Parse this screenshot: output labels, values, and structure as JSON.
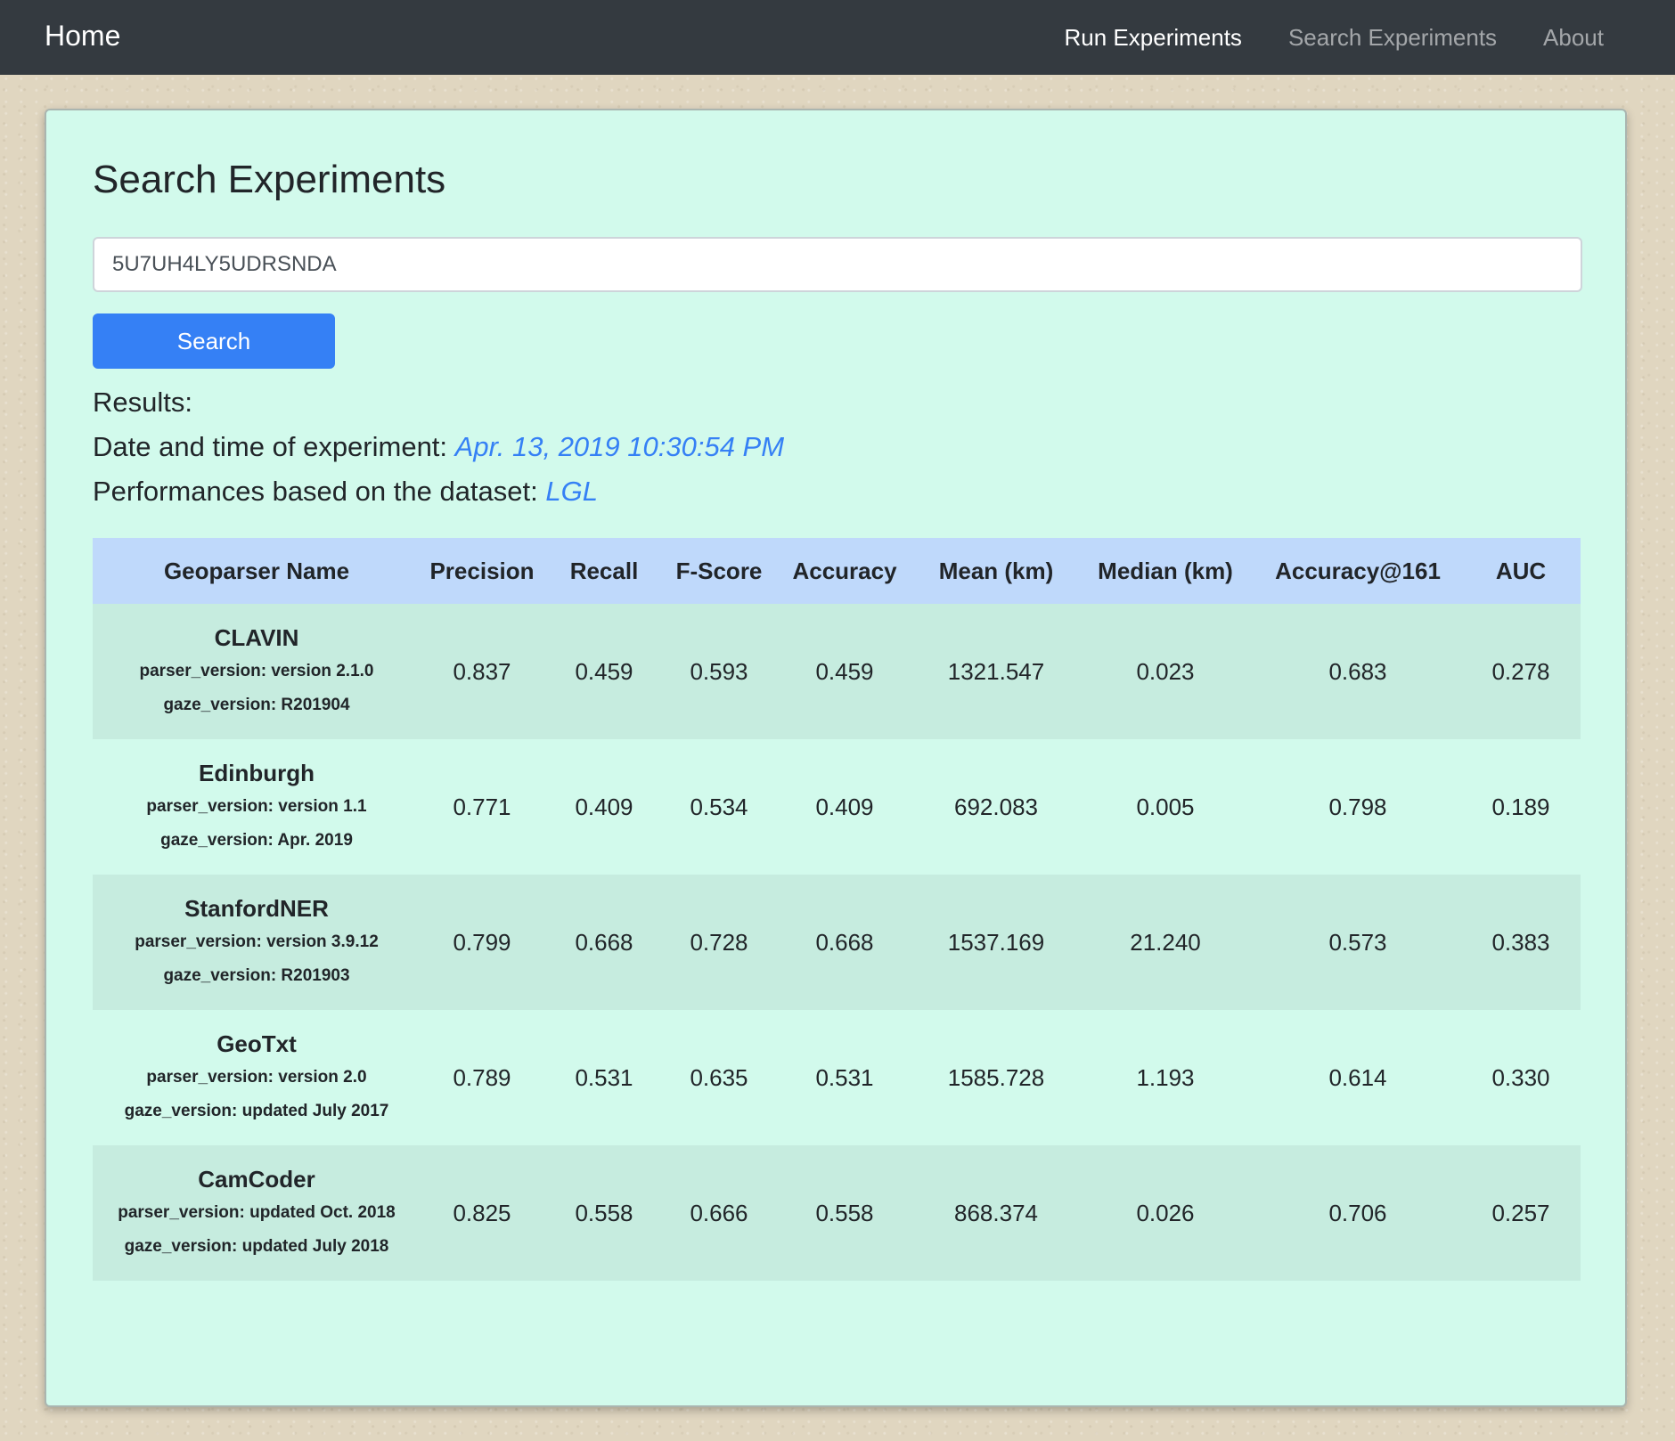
{
  "nav": {
    "brand": "Home",
    "links": [
      {
        "label": "Run Experiments"
      },
      {
        "label": "Search Experiments"
      },
      {
        "label": "About"
      }
    ]
  },
  "page": {
    "title": "Search Experiments",
    "search_value": "5U7UH4LY5UDRSNDA",
    "search_button": "Search",
    "results_label": "Results:",
    "date_label": "Date and time of experiment:",
    "date_value": "Apr. 13, 2019 10:30:54 PM",
    "dataset_label": "Performances based on the dataset:",
    "dataset_value": "LGL"
  },
  "table": {
    "headers": [
      "Geoparser Name",
      "Precision",
      "Recall",
      "F-Score",
      "Accuracy",
      "Mean (km)",
      "Median (km)",
      "Accuracy@161",
      "AUC"
    ],
    "rows": [
      {
        "name": "CLAVIN",
        "parser_version": "parser_version: version 2.1.0",
        "gaze_version": "gaze_version: R201904",
        "values": [
          "0.837",
          "0.459",
          "0.593",
          "0.459",
          "1321.547",
          "0.023",
          "0.683",
          "0.278"
        ]
      },
      {
        "name": "Edinburgh",
        "parser_version": "parser_version: version 1.1",
        "gaze_version": "gaze_version: Apr. 2019",
        "values": [
          "0.771",
          "0.409",
          "0.534",
          "0.409",
          "692.083",
          "0.005",
          "0.798",
          "0.189"
        ]
      },
      {
        "name": "StanfordNER",
        "parser_version": "parser_version: version 3.9.12",
        "gaze_version": "gaze_version: R201903",
        "values": [
          "0.799",
          "0.668",
          "0.728",
          "0.668",
          "1537.169",
          "21.240",
          "0.573",
          "0.383"
        ]
      },
      {
        "name": "GeoTxt",
        "parser_version": "parser_version: version 2.0",
        "gaze_version": "gaze_version: updated July 2017",
        "values": [
          "0.789",
          "0.531",
          "0.635",
          "0.531",
          "1585.728",
          "1.193",
          "0.614",
          "0.330"
        ]
      },
      {
        "name": "CamCoder",
        "parser_version": "parser_version: updated Oct. 2018",
        "gaze_version": "gaze_version: updated July 2018",
        "values": [
          "0.825",
          "0.558",
          "0.666",
          "0.558",
          "868.374",
          "0.026",
          "0.706",
          "0.257"
        ]
      }
    ]
  }
}
